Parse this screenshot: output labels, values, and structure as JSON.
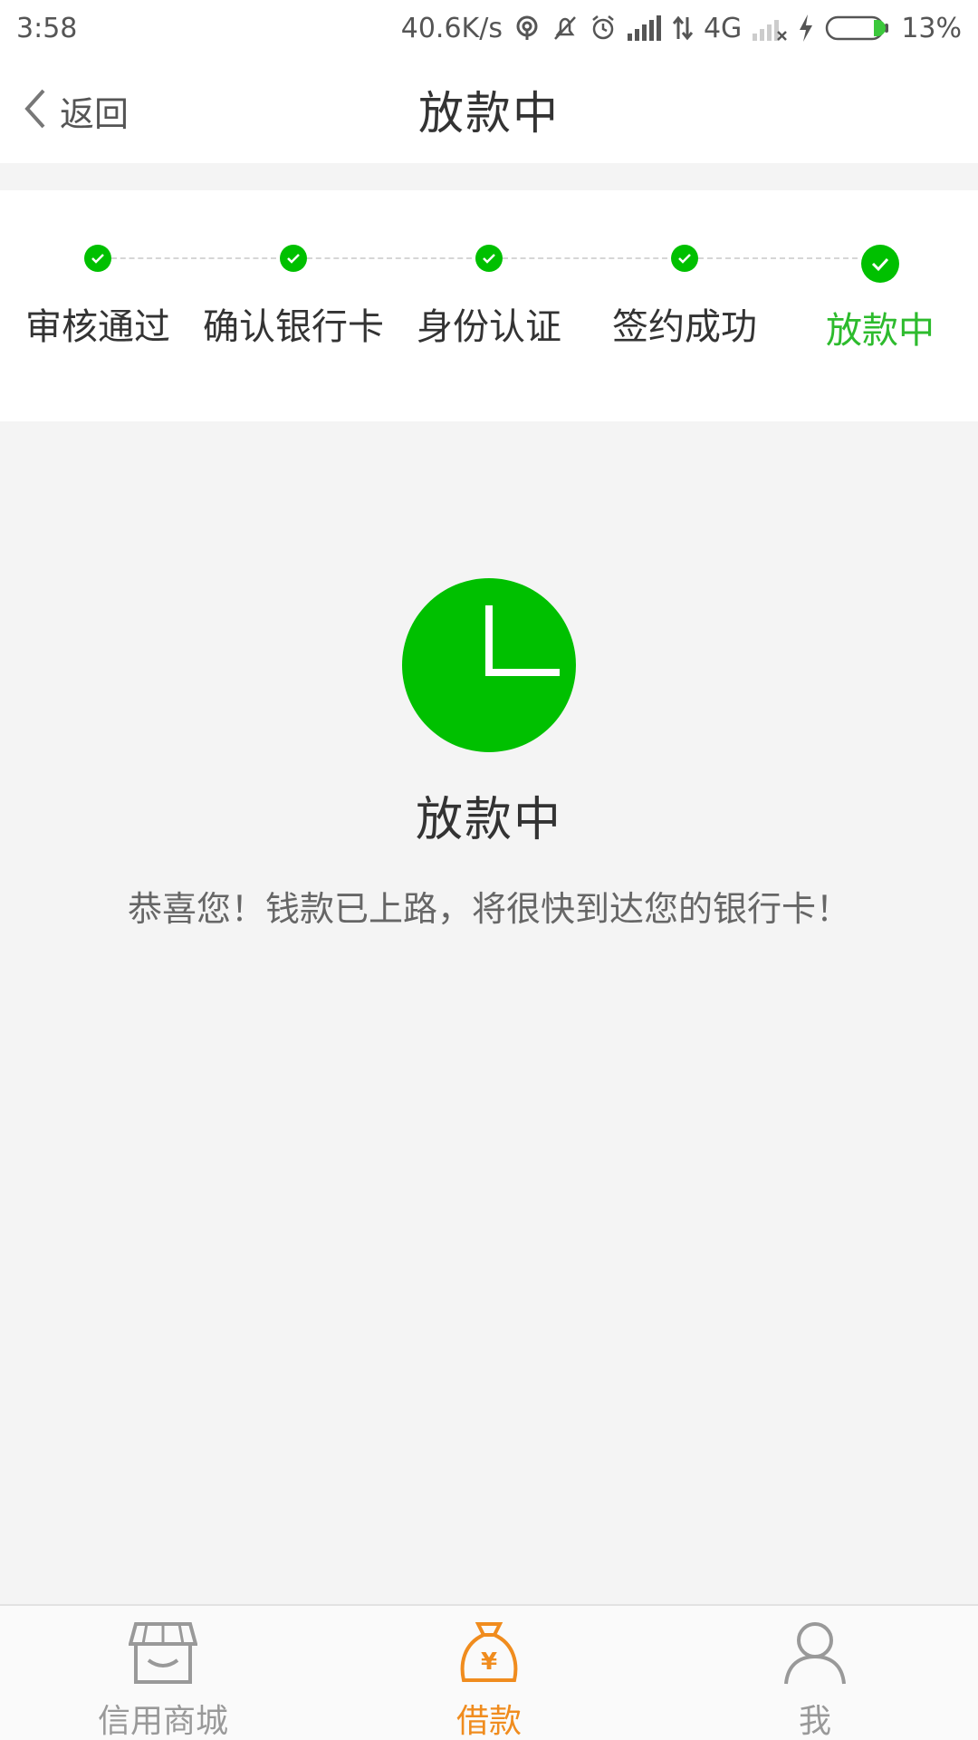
{
  "status_bar": {
    "time": "3:58",
    "net_speed": "40.6K/s",
    "network_type": "4G",
    "battery": "13%"
  },
  "nav": {
    "back_label": "返回",
    "title": "放款中"
  },
  "steps": [
    {
      "label": "审核通过",
      "done": true
    },
    {
      "label": "确认银行卡",
      "done": true
    },
    {
      "label": "身份认证",
      "done": true
    },
    {
      "label": "签约成功",
      "done": true
    },
    {
      "label": "放款中",
      "current": true
    }
  ],
  "result": {
    "icon": "clock-icon",
    "title": "放款中",
    "description": "恭喜您！钱款已上路，将很快到达您的银行卡！"
  },
  "tab_bar": {
    "tabs": [
      {
        "label": "信用商城",
        "icon": "store-icon",
        "active": false
      },
      {
        "label": "借款",
        "icon": "money-bag-icon",
        "active": true
      },
      {
        "label": "我",
        "icon": "user-icon",
        "active": false
      }
    ]
  },
  "colors": {
    "accent_green": "#00c000",
    "active_tab_orange": "#f08c1e"
  }
}
